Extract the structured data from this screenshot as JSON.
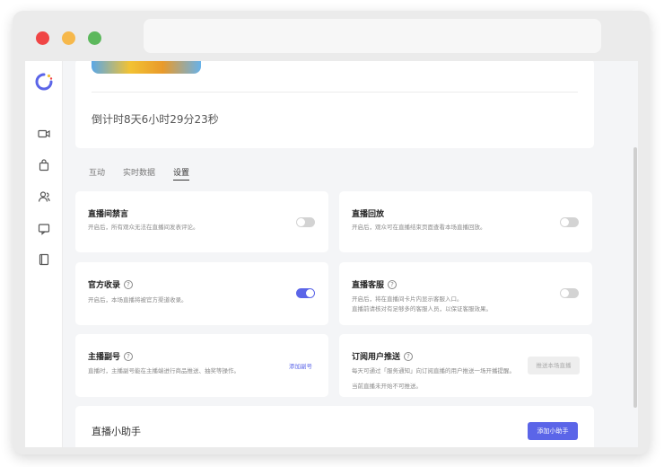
{
  "window": {
    "address": ""
  },
  "sidebar": {
    "items": [
      "video-icon",
      "bag-icon",
      "users-icon",
      "chat-icon",
      "book-icon"
    ]
  },
  "countdown": "倒计时8天6小时29分23秒",
  "tabs": [
    {
      "label": "互动",
      "active": false
    },
    {
      "label": "实时数据",
      "active": false
    },
    {
      "label": "设置",
      "active": true
    }
  ],
  "settings": {
    "ban": {
      "title": "直播间禁言",
      "desc": "开启后，所有观众无法在直播间发表评论。",
      "enabled": false
    },
    "replay": {
      "title": "直播回放",
      "desc": "开启后，观众可在直播结束页面查看本场直播回放。",
      "enabled": false
    },
    "official": {
      "title": "官方收录",
      "desc": "开启后，本场直播将被官方渠道收录。",
      "enabled": true
    },
    "service": {
      "title": "直播客服",
      "desc1": "开启后，将在直播间卡片内显示客服入口。",
      "desc2": "直播前请核对有足够多的客服人员，以保证客服效果。",
      "enabled": false
    },
    "deputy": {
      "title": "主播副号",
      "desc": "直播时，主播副号能在主播端进行商品推送、抽奖等操作。",
      "link": "添加副号"
    },
    "push": {
      "title": "订阅用户推送",
      "desc": "每天可通过「服务通知」向订阅直播的用户推送一场开播提醒。",
      "note": "当前直播未开始不可推送。",
      "button": "推送本场直播"
    }
  },
  "assistant": {
    "title": "直播小助手",
    "button": "添加小助手"
  },
  "colors": {
    "accent": "#5b65e8"
  }
}
